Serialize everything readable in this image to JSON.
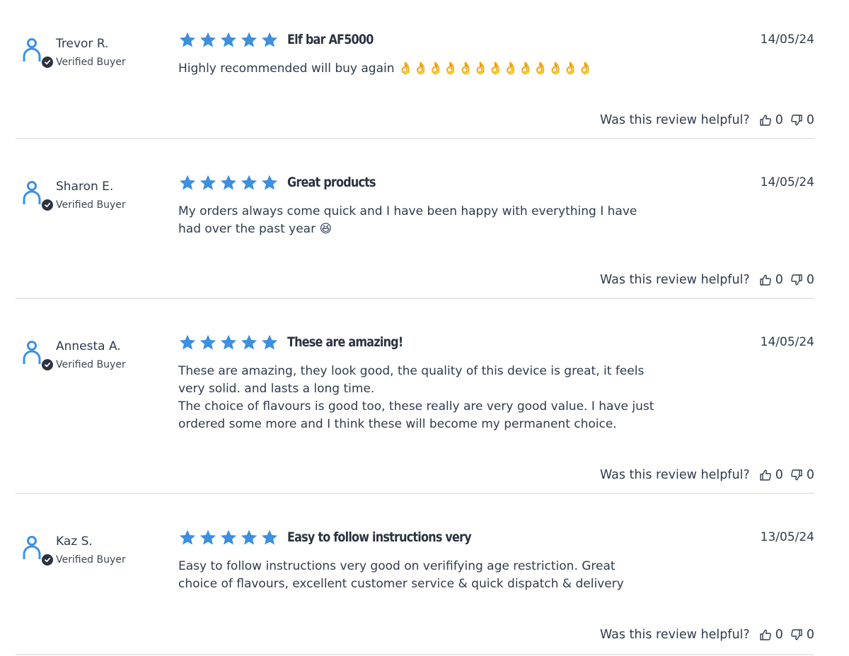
{
  "colors": {
    "star": "#3d8fe0",
    "avatar": "#3d8fe0",
    "text": "#2f3b4d",
    "divider": "#e6e8ea",
    "badge": "#2b3240"
  },
  "reviews": [
    {
      "name": "Trevor R.",
      "badge": "Verified Buyer",
      "rating": 5,
      "title": "Elf bar AF5000",
      "body": "Highly recommended will buy again 👌👌👌👌👌👌👌👌👌👌👌👌👌",
      "date": "14/05/24",
      "helpful_question": "Was this review helpful?",
      "thumbs_up": "0",
      "thumbs_down": "0"
    },
    {
      "name": "Sharon E.",
      "badge": "Verified Buyer",
      "rating": 5,
      "title": "Great products",
      "body": "My orders always come quick and I have been happy with everything I have\nhad over the past year 😆",
      "date": "14/05/24",
      "helpful_question": "Was this review helpful?",
      "thumbs_up": "0",
      "thumbs_down": "0"
    },
    {
      "name": "Annesta A.",
      "badge": "Verified Buyer",
      "rating": 5,
      "title": "These are amazing!",
      "body": "These are amazing, they look good, the quality of this device is great, it feels\nvery solid. and lasts a long time.\nThe choice of flavours is good too, these really are very good value. I have just\nordered some more and I think these will become my permanent choice.",
      "date": "14/05/24",
      "helpful_question": "Was this review helpful?",
      "thumbs_up": "0",
      "thumbs_down": "0"
    },
    {
      "name": "Kaz S.",
      "badge": "Verified Buyer",
      "rating": 5,
      "title": "Easy to follow instructions very",
      "body": "Easy to follow instructions very good on verififying age restriction. Great\nchoice of flavours, excellent customer service & quick dispatch & delivery",
      "date": "13/05/24",
      "helpful_question": "Was this review helpful?",
      "thumbs_up": "0",
      "thumbs_down": "0"
    }
  ]
}
